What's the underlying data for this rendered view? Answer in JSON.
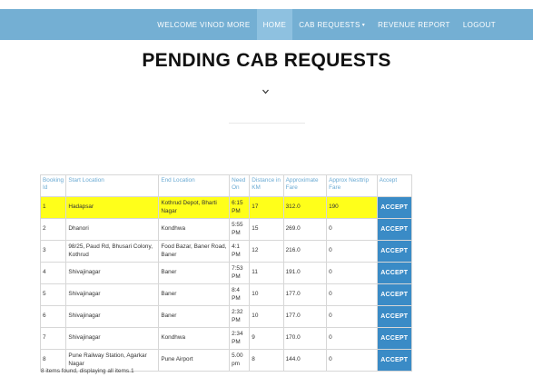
{
  "nav": {
    "items": [
      {
        "label": "WELCOME VINOD MORE",
        "name": "nav-welcome",
        "interactable": false,
        "active": false,
        "caret": false
      },
      {
        "label": "HOME",
        "name": "nav-home",
        "interactable": true,
        "active": true,
        "caret": false
      },
      {
        "label": "CAB REQUESTS",
        "name": "nav-cab-requests",
        "interactable": true,
        "active": false,
        "caret": true
      },
      {
        "label": "REVENUE REPORT",
        "name": "nav-revenue-report",
        "interactable": true,
        "active": false,
        "caret": false
      },
      {
        "label": "LOGOUT",
        "name": "nav-logout",
        "interactable": true,
        "active": false,
        "caret": false
      }
    ]
  },
  "page": {
    "title": "PENDING CAB REQUESTS"
  },
  "table": {
    "headers": [
      "Booking Id",
      "Start Location",
      "End Location",
      "Need On",
      "Distance in KM",
      "Approximate Fare",
      "Approx Nesttrip Fare",
      "Accept"
    ],
    "rows": [
      {
        "id": "1",
        "start": "Hadapsar",
        "end": "Kothrud Depot, Bharti Nagar",
        "need": "6:15 PM",
        "dist": "17",
        "fare": "312.0",
        "nest": "190",
        "accept": "ACCEPT",
        "highlight": true
      },
      {
        "id": "2",
        "start": "Dhanori",
        "end": "Kondhwa",
        "need": "5:55 PM",
        "dist": "15",
        "fare": "269.0",
        "nest": "0",
        "accept": "ACCEPT",
        "highlight": false
      },
      {
        "id": "3",
        "start": "98/25, Paud Rd, Bhusari Colony, Kothrud",
        "end": "Food Bazar, Baner Road, Baner",
        "need": "4:1 PM",
        "dist": "12",
        "fare": "216.0",
        "nest": "0",
        "accept": "ACCEPT",
        "highlight": false
      },
      {
        "id": "4",
        "start": "Shivajinagar",
        "end": "Baner",
        "need": "7:53 PM",
        "dist": "11",
        "fare": "191.0",
        "nest": "0",
        "accept": "ACCEPT",
        "highlight": false
      },
      {
        "id": "5",
        "start": "Shivajinagar",
        "end": "Baner",
        "need": "8:4 PM",
        "dist": "10",
        "fare": "177.0",
        "nest": "0",
        "accept": "ACCEPT",
        "highlight": false
      },
      {
        "id": "6",
        "start": "Shivajinagar",
        "end": "Baner",
        "need": "2:32 PM",
        "dist": "10",
        "fare": "177.0",
        "nest": "0",
        "accept": "ACCEPT",
        "highlight": false
      },
      {
        "id": "7",
        "start": "Shivajinagar",
        "end": "Kondhwa",
        "need": "2:34 PM",
        "dist": "9",
        "fare": "170.0",
        "nest": "0",
        "accept": "ACCEPT",
        "highlight": false
      },
      {
        "id": "8",
        "start": "Pune Railway Station, Agarkar Nagar",
        "end": "Pune Airport",
        "need": "5.00 pm",
        "dist": "8",
        "fare": "144.0",
        "nest": "0",
        "accept": "ACCEPT",
        "highlight": false
      }
    ]
  },
  "footer": {
    "text": "8 items found, displaying all items.1"
  },
  "colors": {
    "navbar": "#74afd3",
    "nav_active": "#8ec1e0",
    "header_text": "#6aaad3",
    "highlight_row": "#ffff1a",
    "accept_button": "#3a8bc6"
  },
  "icons": {
    "expand": "chevron-down-icon",
    "dropdown": "caret-down-icon"
  }
}
